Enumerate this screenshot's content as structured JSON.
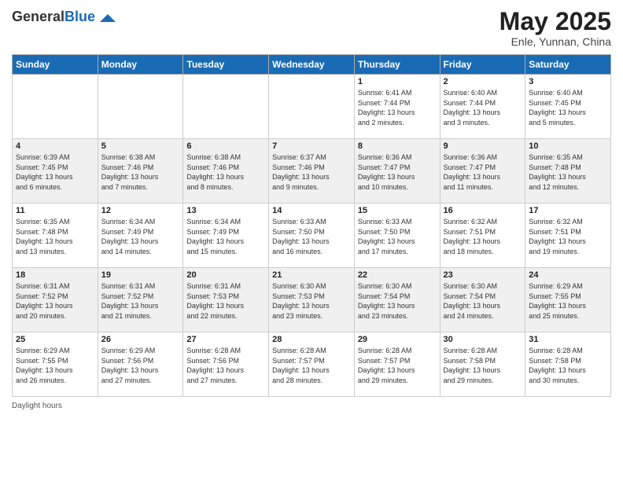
{
  "logo": {
    "general": "General",
    "blue": "Blue"
  },
  "header": {
    "month": "May 2025",
    "location": "Enle, Yunnan, China"
  },
  "days_of_week": [
    "Sunday",
    "Monday",
    "Tuesday",
    "Wednesday",
    "Thursday",
    "Friday",
    "Saturday"
  ],
  "weeks": [
    [
      {
        "day": "",
        "info": ""
      },
      {
        "day": "",
        "info": ""
      },
      {
        "day": "",
        "info": ""
      },
      {
        "day": "",
        "info": ""
      },
      {
        "day": "1",
        "info": "Sunrise: 6:41 AM\nSunset: 7:44 PM\nDaylight: 13 hours\nand 2 minutes."
      },
      {
        "day": "2",
        "info": "Sunrise: 6:40 AM\nSunset: 7:44 PM\nDaylight: 13 hours\nand 3 minutes."
      },
      {
        "day": "3",
        "info": "Sunrise: 6:40 AM\nSunset: 7:45 PM\nDaylight: 13 hours\nand 5 minutes."
      }
    ],
    [
      {
        "day": "4",
        "info": "Sunrise: 6:39 AM\nSunset: 7:45 PM\nDaylight: 13 hours\nand 6 minutes."
      },
      {
        "day": "5",
        "info": "Sunrise: 6:38 AM\nSunset: 7:46 PM\nDaylight: 13 hours\nand 7 minutes."
      },
      {
        "day": "6",
        "info": "Sunrise: 6:38 AM\nSunset: 7:46 PM\nDaylight: 13 hours\nand 8 minutes."
      },
      {
        "day": "7",
        "info": "Sunrise: 6:37 AM\nSunset: 7:46 PM\nDaylight: 13 hours\nand 9 minutes."
      },
      {
        "day": "8",
        "info": "Sunrise: 6:36 AM\nSunset: 7:47 PM\nDaylight: 13 hours\nand 10 minutes."
      },
      {
        "day": "9",
        "info": "Sunrise: 6:36 AM\nSunset: 7:47 PM\nDaylight: 13 hours\nand 11 minutes."
      },
      {
        "day": "10",
        "info": "Sunrise: 6:35 AM\nSunset: 7:48 PM\nDaylight: 13 hours\nand 12 minutes."
      }
    ],
    [
      {
        "day": "11",
        "info": "Sunrise: 6:35 AM\nSunset: 7:48 PM\nDaylight: 13 hours\nand 13 minutes."
      },
      {
        "day": "12",
        "info": "Sunrise: 6:34 AM\nSunset: 7:49 PM\nDaylight: 13 hours\nand 14 minutes."
      },
      {
        "day": "13",
        "info": "Sunrise: 6:34 AM\nSunset: 7:49 PM\nDaylight: 13 hours\nand 15 minutes."
      },
      {
        "day": "14",
        "info": "Sunrise: 6:33 AM\nSunset: 7:50 PM\nDaylight: 13 hours\nand 16 minutes."
      },
      {
        "day": "15",
        "info": "Sunrise: 6:33 AM\nSunset: 7:50 PM\nDaylight: 13 hours\nand 17 minutes."
      },
      {
        "day": "16",
        "info": "Sunrise: 6:32 AM\nSunset: 7:51 PM\nDaylight: 13 hours\nand 18 minutes."
      },
      {
        "day": "17",
        "info": "Sunrise: 6:32 AM\nSunset: 7:51 PM\nDaylight: 13 hours\nand 19 minutes."
      }
    ],
    [
      {
        "day": "18",
        "info": "Sunrise: 6:31 AM\nSunset: 7:52 PM\nDaylight: 13 hours\nand 20 minutes."
      },
      {
        "day": "19",
        "info": "Sunrise: 6:31 AM\nSunset: 7:52 PM\nDaylight: 13 hours\nand 21 minutes."
      },
      {
        "day": "20",
        "info": "Sunrise: 6:31 AM\nSunset: 7:53 PM\nDaylight: 13 hours\nand 22 minutes."
      },
      {
        "day": "21",
        "info": "Sunrise: 6:30 AM\nSunset: 7:53 PM\nDaylight: 13 hours\nand 23 minutes."
      },
      {
        "day": "22",
        "info": "Sunrise: 6:30 AM\nSunset: 7:54 PM\nDaylight: 13 hours\nand 23 minutes."
      },
      {
        "day": "23",
        "info": "Sunrise: 6:30 AM\nSunset: 7:54 PM\nDaylight: 13 hours\nand 24 minutes."
      },
      {
        "day": "24",
        "info": "Sunrise: 6:29 AM\nSunset: 7:55 PM\nDaylight: 13 hours\nand 25 minutes."
      }
    ],
    [
      {
        "day": "25",
        "info": "Sunrise: 6:29 AM\nSunset: 7:55 PM\nDaylight: 13 hours\nand 26 minutes."
      },
      {
        "day": "26",
        "info": "Sunrise: 6:29 AM\nSunset: 7:56 PM\nDaylight: 13 hours\nand 27 minutes."
      },
      {
        "day": "27",
        "info": "Sunrise: 6:28 AM\nSunset: 7:56 PM\nDaylight: 13 hours\nand 27 minutes."
      },
      {
        "day": "28",
        "info": "Sunrise: 6:28 AM\nSunset: 7:57 PM\nDaylight: 13 hours\nand 28 minutes."
      },
      {
        "day": "29",
        "info": "Sunrise: 6:28 AM\nSunset: 7:57 PM\nDaylight: 13 hours\nand 29 minutes."
      },
      {
        "day": "30",
        "info": "Sunrise: 6:28 AM\nSunset: 7:58 PM\nDaylight: 13 hours\nand 29 minutes."
      },
      {
        "day": "31",
        "info": "Sunrise: 6:28 AM\nSunset: 7:58 PM\nDaylight: 13 hours\nand 30 minutes."
      }
    ]
  ],
  "footer": {
    "daylight_hours": "Daylight hours"
  }
}
